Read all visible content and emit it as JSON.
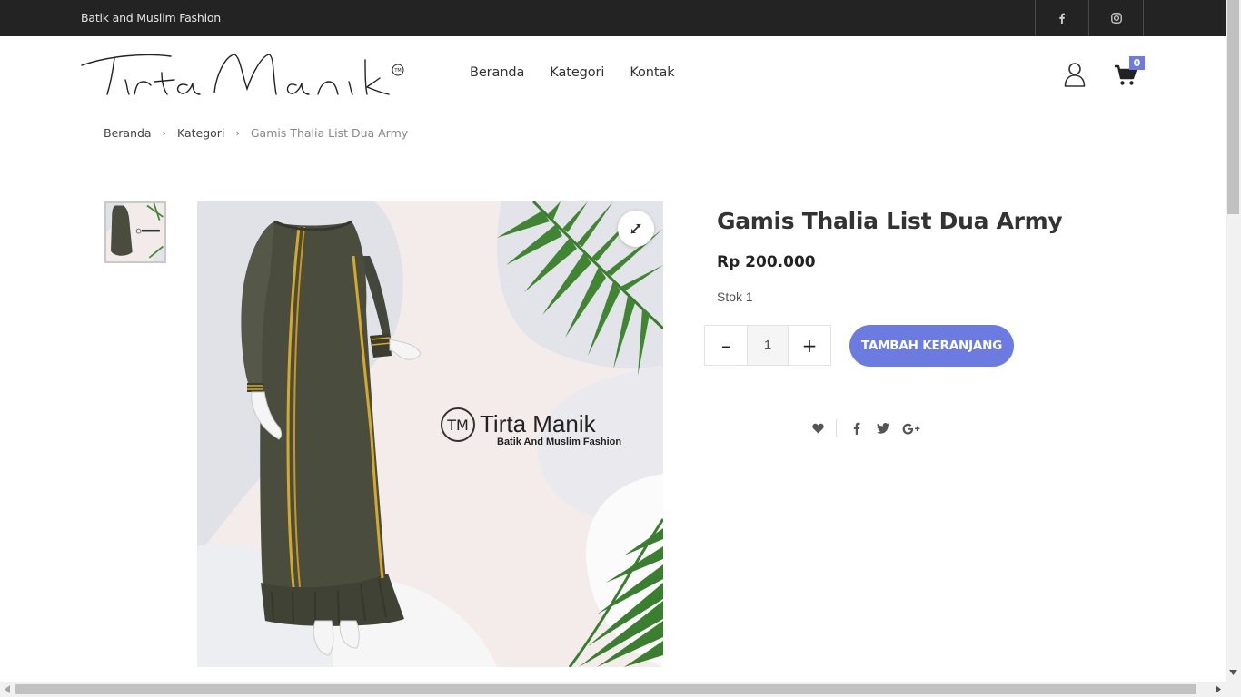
{
  "topbar": {
    "tagline": "Batik and Muslim Fashion",
    "social": [
      "facebook-icon",
      "instagram-icon"
    ]
  },
  "header": {
    "logo_text": "Tirta Manik",
    "nav": [
      "Beranda",
      "Kategori",
      "Kontak"
    ],
    "cart_count": "0"
  },
  "breadcrumb": {
    "items": [
      "Beranda",
      "Kategori",
      "Gamis Thalia List Dua Army"
    ]
  },
  "product": {
    "title": "Gamis Thalia List Dua Army",
    "price": "Rp 200.000",
    "stock": "Stok 1",
    "quantity": "1",
    "minus": "–",
    "plus": "+",
    "add_to_cart": "TAMBAH KERANJANG",
    "image_brand": "Tirta Manik",
    "image_brand_sub": "Batik And Muslim Fashion",
    "image_brand_mark": "TM"
  },
  "colors": {
    "accent": "#6c7be0",
    "topbar": "#232323",
    "dress": "#4a4d3d",
    "stripe": "#d6a92a"
  }
}
